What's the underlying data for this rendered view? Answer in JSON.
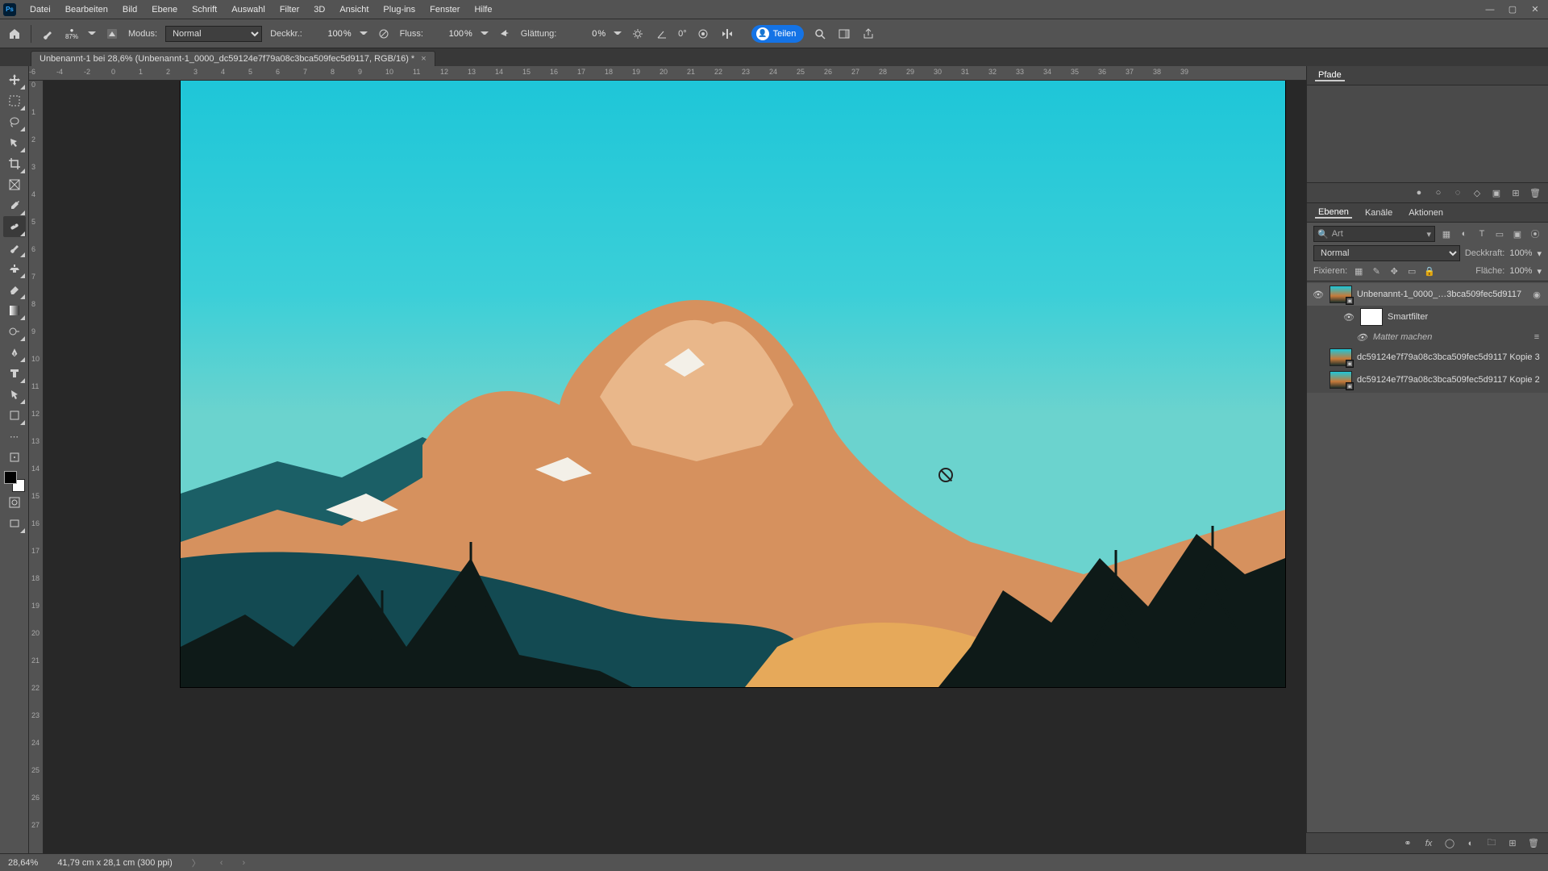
{
  "app": {
    "logo_text": "Ps"
  },
  "menu": {
    "items": [
      "Datei",
      "Bearbeiten",
      "Bild",
      "Ebene",
      "Schrift",
      "Auswahl",
      "Filter",
      "3D",
      "Ansicht",
      "Plug-ins",
      "Fenster",
      "Hilfe"
    ]
  },
  "options": {
    "brush_size": "87%",
    "mode_label": "Modus:",
    "mode_value": "Normal",
    "opacity_label": "Deckkr.:",
    "opacity_value": "100",
    "flow_label": "Fluss:",
    "flow_value": "100",
    "smoothing_label": "Glättung:",
    "smoothing_value": "0",
    "angle_label": "0°",
    "share_label": "Teilen"
  },
  "doc_tab": {
    "title": "Unbenannt-1 bei 28,6% (Unbenannt-1_0000_dc59124e7f79a08c3bca509fec5d9117, RGB/16) *"
  },
  "ruler": {
    "h": [
      "-6",
      "-4",
      "-2",
      "0",
      "1",
      "2",
      "3",
      "4",
      "5",
      "6",
      "7",
      "8",
      "9",
      "10",
      "11",
      "12",
      "13",
      "14",
      "15",
      "16",
      "17",
      "18",
      "19",
      "20",
      "21",
      "22",
      "23",
      "24",
      "25",
      "26",
      "27",
      "28",
      "29",
      "30",
      "31",
      "32",
      "33",
      "34",
      "35",
      "36",
      "37",
      "38",
      "39"
    ],
    "v": [
      "0",
      "1",
      "2",
      "3",
      "4",
      "5",
      "6",
      "7",
      "8",
      "9",
      "10",
      "11",
      "12",
      "13",
      "14",
      "15",
      "16",
      "17",
      "18",
      "19",
      "20",
      "21",
      "22",
      "23",
      "24",
      "25",
      "26",
      "27"
    ]
  },
  "panels": {
    "paths_tab": "Pfade",
    "layers_tabs": [
      "Ebenen",
      "Kanäle",
      "Aktionen"
    ],
    "search_placeholder": "Art",
    "blend_mode": "Normal",
    "opacity_label": "Deckkraft:",
    "opacity_value": "100%",
    "lock_label": "Fixieren:",
    "fill_label": "Fläche:",
    "fill_value": "100%"
  },
  "layers": [
    {
      "name": "Unbenannt-1_0000_…3bca509fec5d9117",
      "selected": true,
      "visible": true,
      "smart": true
    },
    {
      "name": "Smartfilter",
      "sub": true,
      "mask": true
    },
    {
      "name": "Matter machen",
      "sub2": true
    },
    {
      "name": "dc59124e7f79a08c3bca509fec5d9117 Kopie 3",
      "smart": true
    },
    {
      "name": "dc59124e7f79a08c3bca509fec5d9117 Kopie 2",
      "smart": true
    }
  ],
  "status": {
    "zoom": "28,64%",
    "docinfo": "41,79 cm x 28,1 cm (300 ppi)"
  }
}
